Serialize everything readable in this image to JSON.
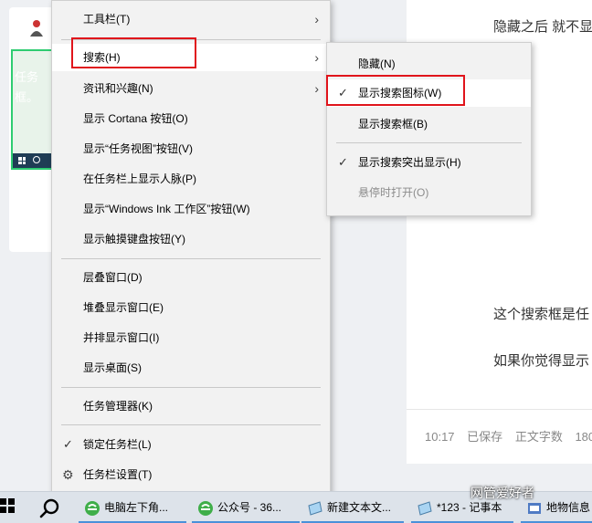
{
  "document": {
    "line1": "隐藏之后 就不显",
    "line2": "这个搜索框是任",
    "line3": "如果你觉得显示",
    "status_time": "10:17",
    "status_saved": "已保存",
    "status_wordcount_label": "正文字数",
    "status_wordcount_value": "180",
    "thumb_text": "任务\n框。"
  },
  "main_menu": {
    "items": [
      {
        "label": "工具栏(T)"
      },
      {
        "label": "搜索(H)"
      },
      {
        "label": "资讯和兴趣(N)"
      },
      {
        "label": "显示 Cortana 按钮(O)"
      },
      {
        "label": "显示“任务视图”按钮(V)"
      },
      {
        "label": "在任务栏上显示人脉(P)"
      },
      {
        "label": "显示“Windows Ink 工作区”按钮(W)"
      },
      {
        "label": "显示触摸键盘按钮(Y)"
      },
      {
        "label": "层叠窗口(D)"
      },
      {
        "label": "堆叠显示窗口(E)"
      },
      {
        "label": "并排显示窗口(I)"
      },
      {
        "label": "显示桌面(S)"
      },
      {
        "label": "任务管理器(K)"
      },
      {
        "label": "锁定任务栏(L)",
        "checked": true
      },
      {
        "label": "任务栏设置(T)",
        "icon": "gear-icon"
      }
    ]
  },
  "sub_menu": {
    "items": [
      {
        "label": "隐藏(N)"
      },
      {
        "label": "显示搜索图标(W)",
        "checked": true
      },
      {
        "label": "显示搜索框(B)"
      },
      {
        "label": "显示搜索突出显示(H)",
        "checked": true
      },
      {
        "label": "悬停时打开(O)",
        "disabled": true
      }
    ]
  },
  "taskbar": {
    "items": [
      {
        "label": "电脑左下角...",
        "icon": "browser-icon"
      },
      {
        "label": "公众号 - 36...",
        "icon": "browser-icon"
      },
      {
        "label": "新建文本文...",
        "icon": "notepad-icon"
      },
      {
        "label": "*123 - 记事本",
        "icon": "notepad-icon"
      },
      {
        "label": "地物信息",
        "icon": "app-icon"
      }
    ],
    "watermark": "网管爱好者"
  },
  "colors": {
    "highlight": "#e0141b",
    "menu_bg": "#f2f2f2",
    "taskbar_bg": "#dde3ea",
    "thumb_border": "#2ecc71"
  }
}
